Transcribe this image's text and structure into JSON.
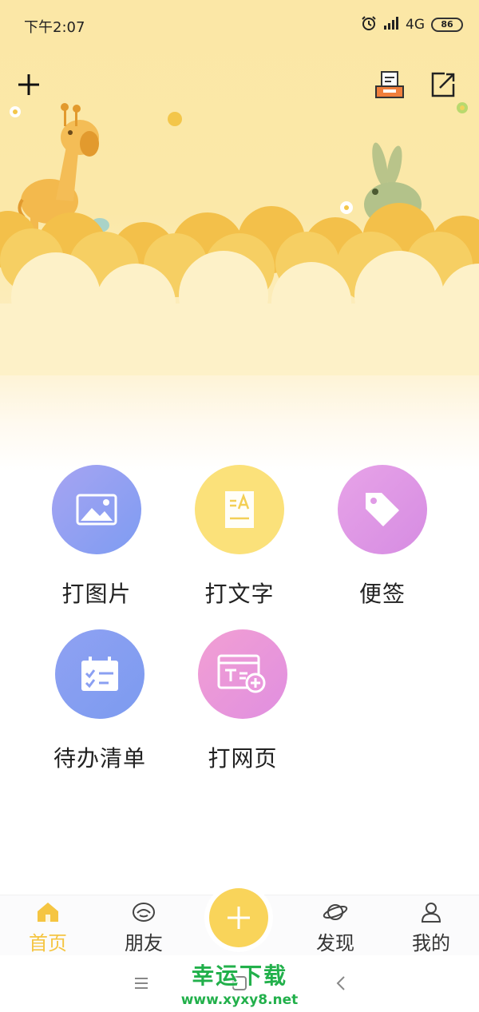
{
  "status_bar": {
    "time": "下午2:07",
    "network": "4G",
    "battery": "86"
  },
  "top_bar": {
    "add_icon": "plus-icon",
    "printer_icon": "printer-icon",
    "share_icon": "share-icon"
  },
  "functions": [
    {
      "label": "打图片",
      "icon": "image-icon",
      "color": "#8f9ff2"
    },
    {
      "label": "打文字",
      "icon": "document-text-icon",
      "color": "#fbe17a"
    },
    {
      "label": "便签",
      "icon": "tag-icon",
      "color": "#e09be6"
    },
    {
      "label": "待办清单",
      "icon": "calendar-checklist-icon",
      "color": "#8a9ff2"
    },
    {
      "label": "打网页",
      "icon": "webpage-add-icon",
      "color": "#ea98dc"
    }
  ],
  "bottom_nav": {
    "items": [
      {
        "label": "首页",
        "icon": "home-icon",
        "active": true
      },
      {
        "label": "朋友",
        "icon": "friends-icon",
        "active": false
      },
      {
        "label": "发现",
        "icon": "planet-icon",
        "active": false
      },
      {
        "label": "我的",
        "icon": "profile-icon",
        "active": false
      }
    ],
    "fab_icon": "plus-icon",
    "active_color": "#f5c542"
  },
  "system_nav": {
    "menu_icon": "menu-icon",
    "home_icon": "square-home-icon",
    "back_icon": "back-chevron-icon"
  },
  "watermark": {
    "title": "幸运下载",
    "url": "www.xyxy8.net"
  }
}
